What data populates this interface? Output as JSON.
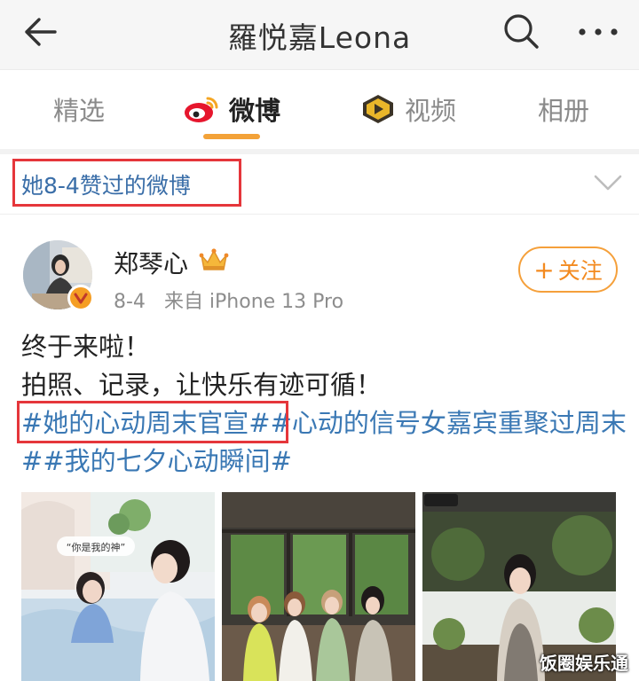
{
  "header": {
    "title": "羅悦嘉Leona",
    "back_icon": "back-arrow-icon",
    "search_icon": "search-icon",
    "more_icon": "more-icon"
  },
  "tabs": [
    {
      "label": "精选",
      "active": false
    },
    {
      "label": "微博",
      "active": true,
      "icon": "weibo-logo-icon"
    },
    {
      "label": "视频",
      "active": false,
      "icon": "video-play-icon"
    },
    {
      "label": "相册",
      "active": false
    }
  ],
  "filter": {
    "label": "她8-4赞过的微博",
    "icon": "chevron-down-icon"
  },
  "post": {
    "username": "郑琴心",
    "date": "8-4",
    "source": "来自 iPhone 13 Pro",
    "follow_label": "关注",
    "lines": [
      "终于来啦！",
      "拍照、记录，让快乐有迹可循！"
    ],
    "topic_1": "#她的心动周末官宣#",
    "topic_2": "#心动的信号女嘉宾重聚过周末#",
    "topic_3": "#我的七夕心动瞬间#",
    "photo_1_caption": "“你是我的神”"
  },
  "watermark": "饭圈娱乐通",
  "colors": {
    "accent": "#f3a238",
    "link": "#3a78b4",
    "highlight_box": "#e5363b",
    "follow": "#f38a1f"
  }
}
